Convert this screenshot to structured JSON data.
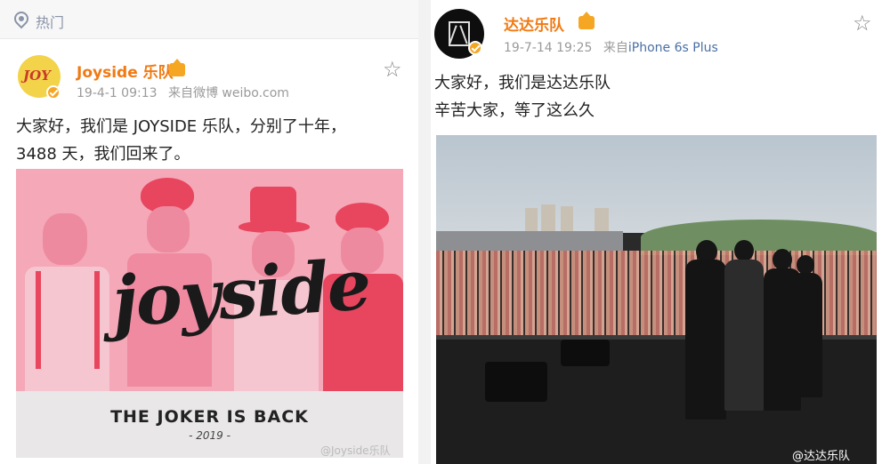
{
  "left_post": {
    "hot_label": "热门",
    "author": "Joyside 乐队",
    "timestamp": "19-4-1 09:13",
    "source": "来自微博 weibo.com",
    "text_line1": "大家好，我们是 JOYSIDE 乐队，分别了十年，",
    "text_line2": "3488 天，我们回来了。",
    "image": {
      "logo_text": "joyside",
      "tagline": "THE JOKER IS BACK",
      "year": "- 2019 -",
      "watermark": "@Joyside乐队"
    },
    "avatar_text": "JOY"
  },
  "right_post": {
    "author": "达达乐队",
    "timestamp": "19-7-14 19:25",
    "source_prefix": "来自",
    "device": "iPhone 6s Plus",
    "text_line1": "大家好，我们是达达乐队",
    "text_line2": "辛苦大家，等了这么久",
    "watermark": "@达达乐队"
  },
  "colors": {
    "name_orange": "#f07a13",
    "verified_gold": "#f5a623",
    "device_blue": "#4a6fa5"
  },
  "icons": {
    "hot": "location-pin-icon",
    "favorite": "star-outline-icon"
  }
}
